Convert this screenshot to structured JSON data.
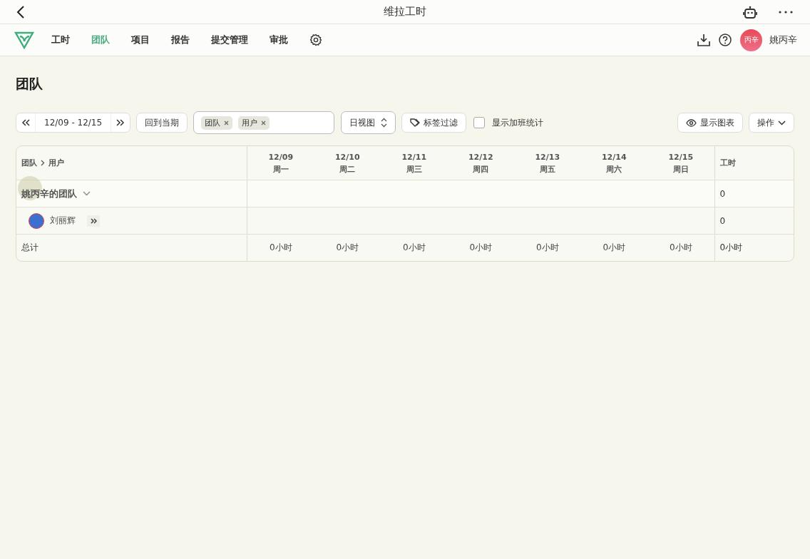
{
  "window": {
    "title": "维拉工时"
  },
  "nav": {
    "items": [
      {
        "label": "工时",
        "selected": false
      },
      {
        "label": "团队",
        "selected": true
      },
      {
        "label": "项目",
        "selected": false
      },
      {
        "label": "报告",
        "selected": false
      },
      {
        "label": "提交管理",
        "selected": false
      },
      {
        "label": "审批",
        "selected": false
      }
    ]
  },
  "user": {
    "avatar_text": "丙辛",
    "name": "姚丙辛"
  },
  "page_title": "团队",
  "toolbar": {
    "date_range": "12/09 - 12/15",
    "current_button": "回到当期",
    "group_tags": [
      "团队",
      "用户"
    ],
    "view_select": "日视图",
    "tag_filter": "标签过滤",
    "overtime": {
      "label": "显示加班统计",
      "checked": false
    },
    "chart_button": "显示图表",
    "actions_button": "操作"
  },
  "table": {
    "breadcrumb": [
      "团队",
      "用户"
    ],
    "days": [
      {
        "date": "12/09",
        "weekday": "周一"
      },
      {
        "date": "12/10",
        "weekday": "周二"
      },
      {
        "date": "12/11",
        "weekday": "周三"
      },
      {
        "date": "12/12",
        "weekday": "周四"
      },
      {
        "date": "12/13",
        "weekday": "周五"
      },
      {
        "date": "12/14",
        "weekday": "周六"
      },
      {
        "date": "12/15",
        "weekday": "周日"
      }
    ],
    "hours_header": "工时",
    "group": {
      "name": "姚丙辛的团队",
      "expanded": true,
      "total": "0"
    },
    "members": [
      {
        "name": "刘丽辉",
        "total": "0"
      }
    ],
    "totals": {
      "label": "总计",
      "days": [
        "0小时",
        "0小时",
        "0小时",
        "0小时",
        "0小时",
        "0小时",
        "0小时"
      ],
      "sum": "0小时"
    }
  }
}
